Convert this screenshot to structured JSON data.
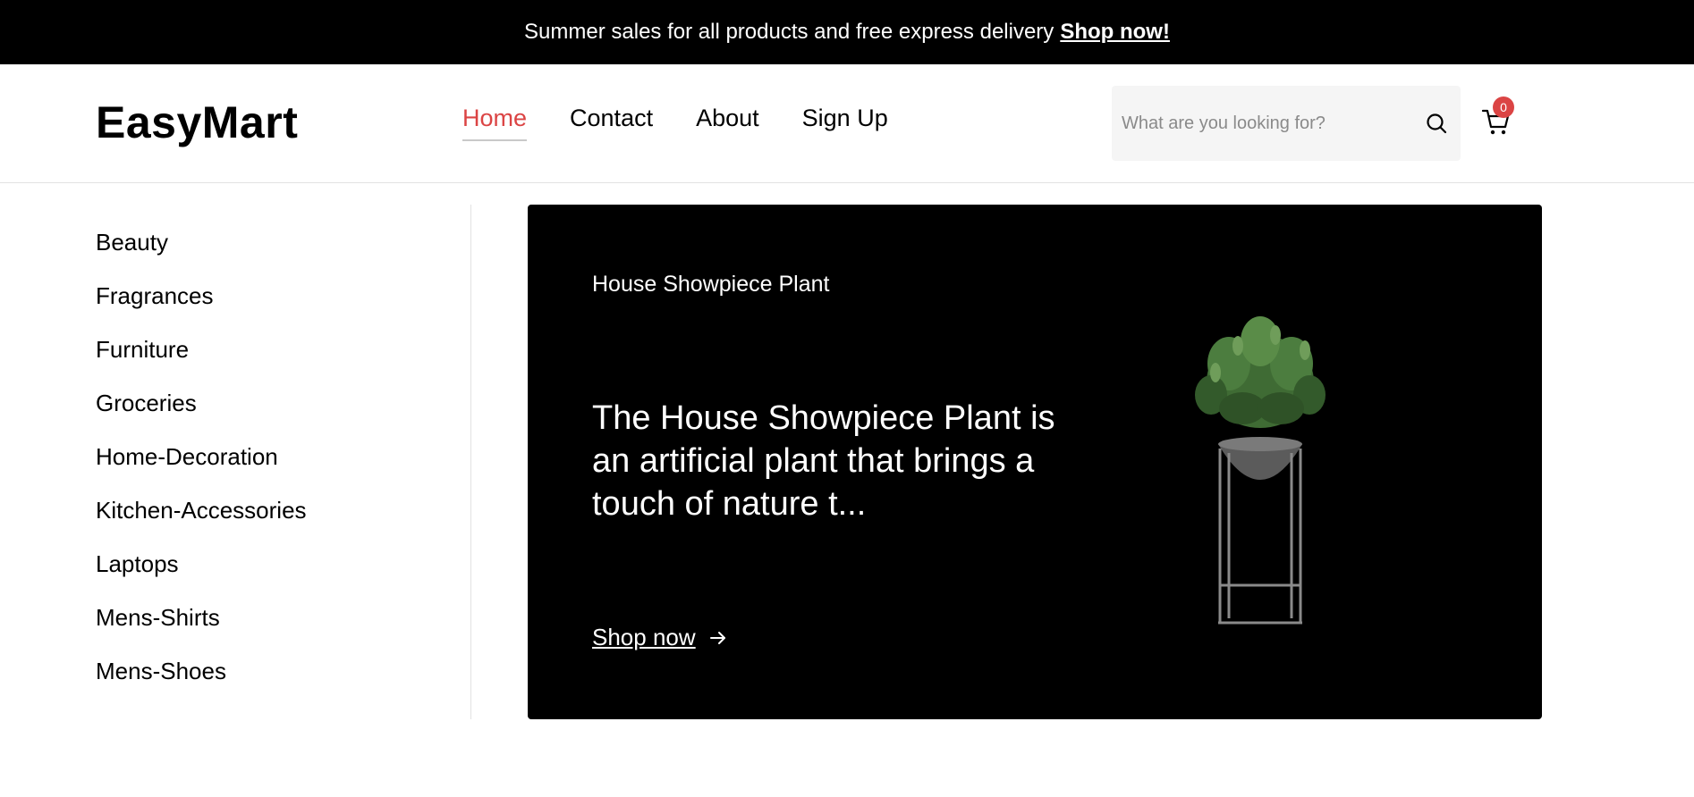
{
  "promo": {
    "text": "Summer sales for all products and free express delivery",
    "link": "Shop now!"
  },
  "header": {
    "logo": "EasyMart",
    "nav": [
      {
        "label": "Home",
        "active": true
      },
      {
        "label": "Contact",
        "active": false
      },
      {
        "label": "About",
        "active": false
      },
      {
        "label": "Sign Up",
        "active": false
      }
    ],
    "search": {
      "placeholder": "What are you looking for?",
      "value": "",
      "icon": "search-icon"
    },
    "cart": {
      "icon": "cart-icon",
      "count": "0"
    }
  },
  "sidebar": {
    "categories": [
      "Beauty",
      "Fragrances",
      "Furniture",
      "Groceries",
      "Home-Decoration",
      "Kitchen-Accessories",
      "Laptops",
      "Mens-Shirts",
      "Mens-Shoes"
    ]
  },
  "hero": {
    "title": "House Showpiece Plant",
    "description": "The House Showpiece Plant is an artificial plant that brings a touch of nature t...",
    "cta": "Shop now",
    "cta_icon": "arrow-right-icon"
  },
  "colors": {
    "accent": "#db4444",
    "banner_bg": "#000000",
    "search_bg": "#f5f5f5"
  }
}
